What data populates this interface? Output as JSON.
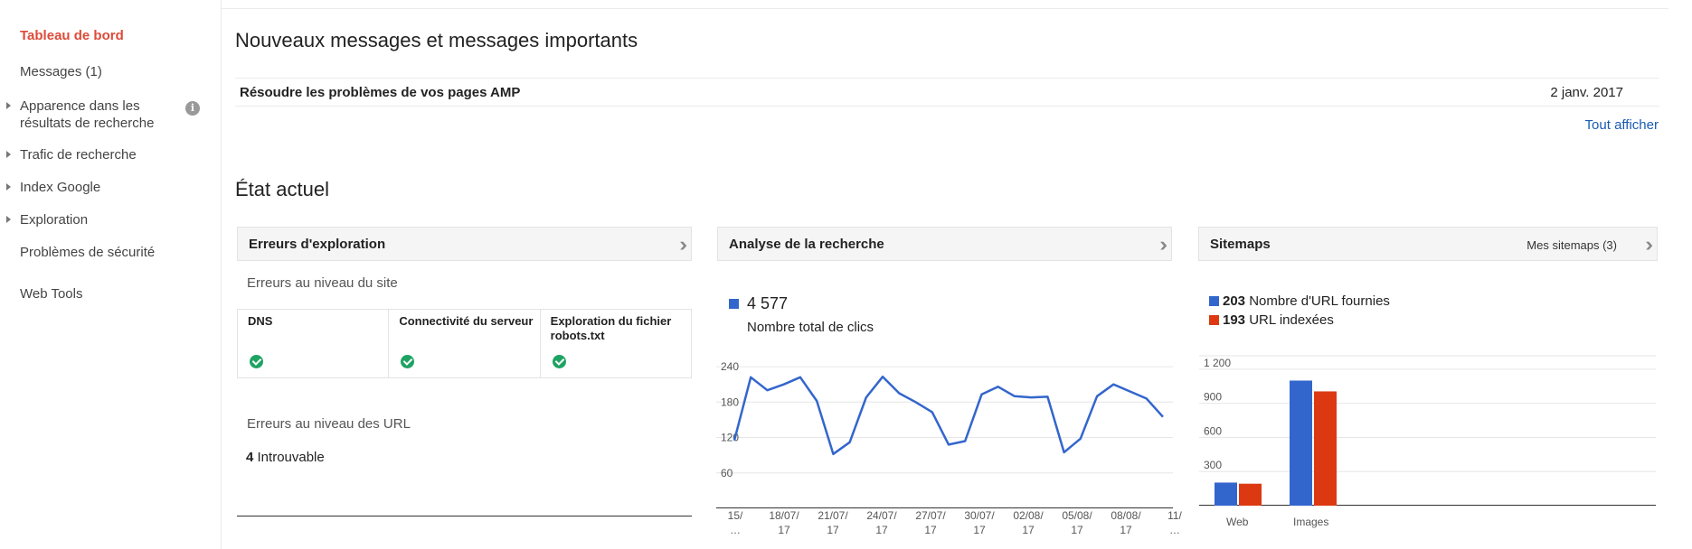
{
  "sidebar": {
    "items": [
      {
        "label": "Tableau de bord",
        "active": true,
        "expandable": false
      },
      {
        "label": "Messages (1)",
        "active": false,
        "expandable": false
      },
      {
        "label": "Apparence dans les résultats de recherche",
        "active": false,
        "expandable": true
      },
      {
        "label": "Trafic de recherche",
        "active": false,
        "expandable": true
      },
      {
        "label": "Index Google",
        "active": false,
        "expandable": true
      },
      {
        "label": "Exploration",
        "active": false,
        "expandable": true
      },
      {
        "label": "Problèmes de sécurité",
        "active": false,
        "expandable": false
      },
      {
        "label": "Web Tools",
        "active": false,
        "expandable": false
      }
    ],
    "info_icon": "info-icon"
  },
  "messages": {
    "heading": "Nouveaux messages et messages importants",
    "items": [
      {
        "title": "Résoudre les problèmes de vos pages AMP",
        "date": "2 janv. 2017"
      }
    ],
    "see_all": "Tout afficher"
  },
  "status": {
    "heading": "État actuel"
  },
  "crawl_errors": {
    "title": "Erreurs d'exploration",
    "site_level": "Erreurs au niveau du site",
    "columns": [
      {
        "label": "DNS",
        "status": "ok"
      },
      {
        "label": "Connectivité du serveur",
        "status": "ok"
      },
      {
        "label": "Exploration du fichier robots.txt",
        "status": "ok"
      }
    ],
    "url_level": "Erreurs au niveau des URL",
    "not_found_count": "4",
    "not_found_label": "Introuvable"
  },
  "search_analytics": {
    "title": "Analyse de la recherche",
    "total": "4 577",
    "total_label": "Nombre total de clics",
    "color": "#3366cc"
  },
  "sitemaps": {
    "title": "Sitemaps",
    "link": "Mes sitemaps (3)",
    "legend": [
      {
        "count": "203",
        "label": "Nombre d'URL fournies",
        "color": "#3366cc"
      },
      {
        "count": "193",
        "label": "URL indexées",
        "color": "#dc3912"
      }
    ]
  },
  "chart_data": [
    {
      "type": "line",
      "title": "",
      "series": [
        {
          "values": [
            115,
            222,
            200,
            210,
            222,
            182,
            92,
            112,
            188,
            223,
            195,
            180,
            163,
            108,
            114,
            193,
            206,
            190,
            188,
            189,
            95,
            118,
            190,
            210,
            198,
            186,
            155
          ]
        }
      ],
      "x_tick_labels": [
        "15/…",
        "18/07/17",
        "21/07/17",
        "24/07/17",
        "27/07/17",
        "30/07/17",
        "02/08/17",
        "05/08/17",
        "08/08/17",
        "11/…"
      ],
      "y_ticks": [
        60,
        120,
        180,
        240
      ],
      "ylim": [
        0,
        260
      ],
      "grid": true
    },
    {
      "type": "bar",
      "categories": [
        "Web",
        "Images"
      ],
      "series": [
        {
          "name": "Nombre d'URL fournies",
          "values": [
            203,
            1100
          ]
        },
        {
          "name": "URL indexées",
          "values": [
            193,
            1005
          ]
        }
      ],
      "y_ticks": [
        "300",
        "600",
        "900",
        "1 200"
      ],
      "ylim": [
        0,
        1350
      ],
      "grid": true
    }
  ]
}
